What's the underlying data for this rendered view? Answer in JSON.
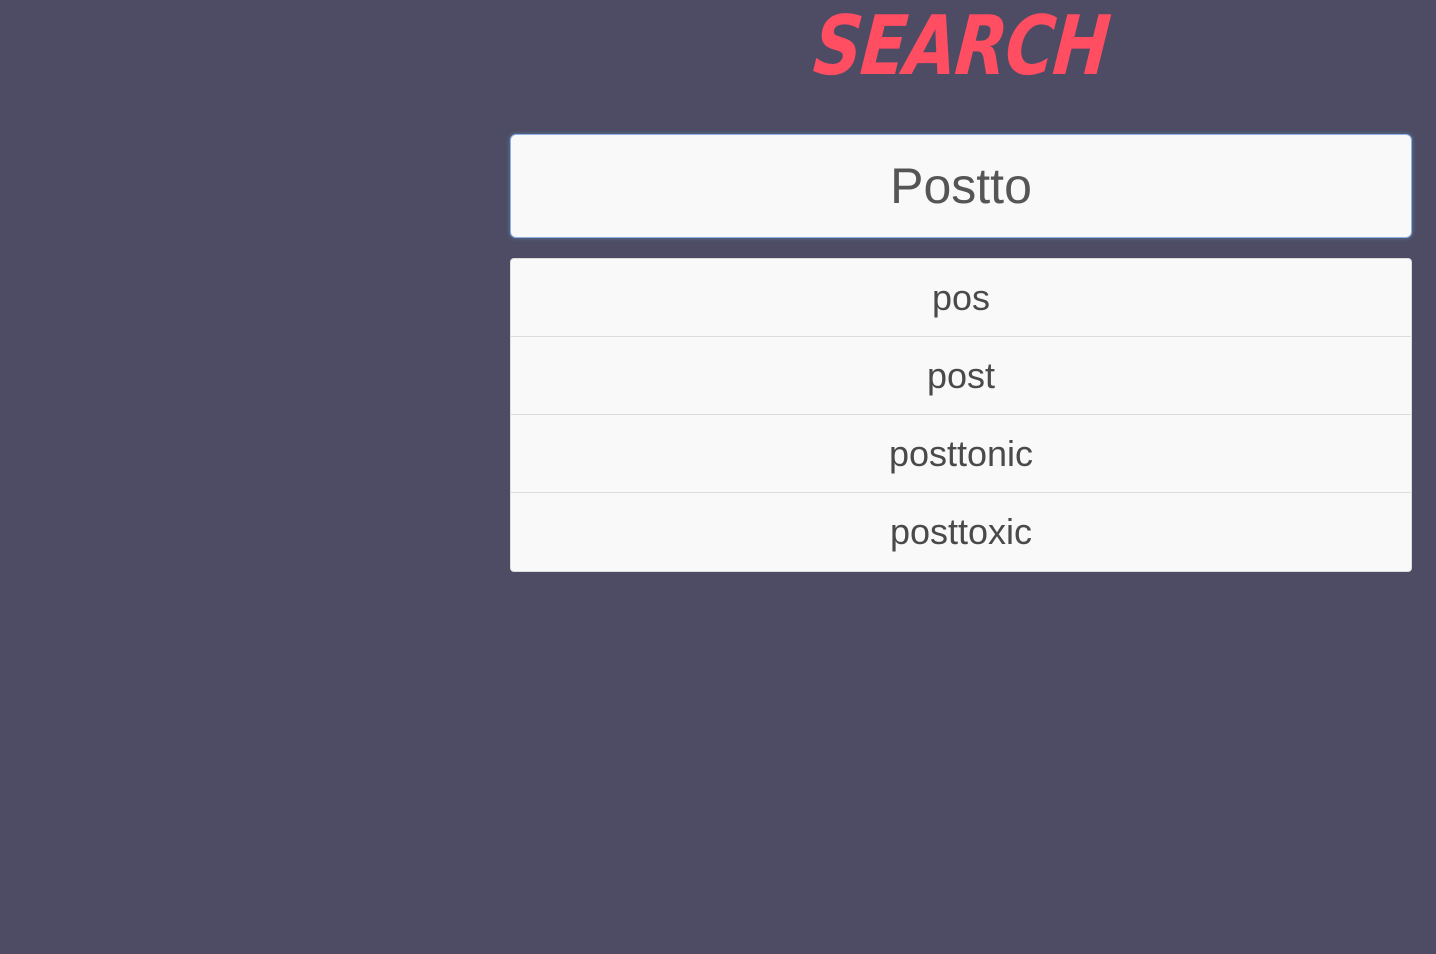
{
  "header": {
    "title": "SEARCH"
  },
  "search": {
    "value": "Postto",
    "placeholder": ""
  },
  "suggestions": [
    {
      "label": "pos"
    },
    {
      "label": "post"
    },
    {
      "label": "posttonic"
    },
    {
      "label": "posttoxic"
    }
  ],
  "colors": {
    "background": "#4e4c64",
    "accent": "#ff4d62",
    "panel": "#f9f9f9",
    "text": "#4a4a4a"
  }
}
